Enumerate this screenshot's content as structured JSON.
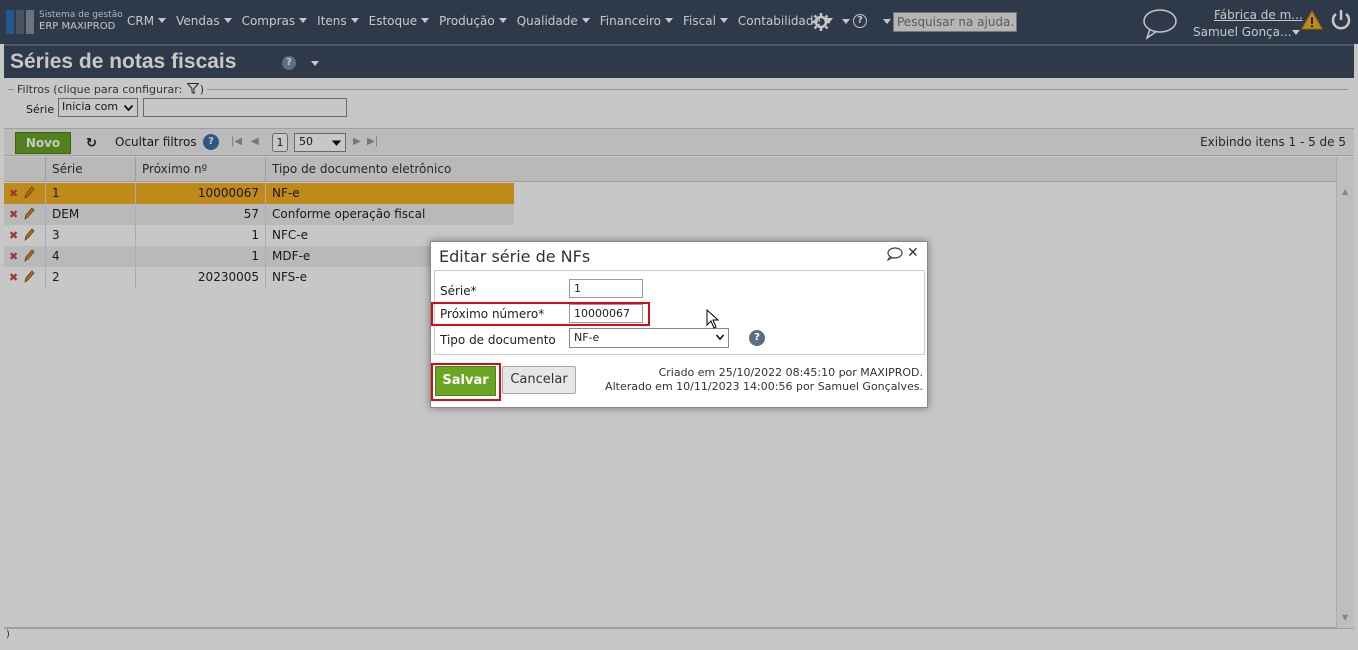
{
  "app": {
    "brand_line1": "Sistema de gestão",
    "brand_line2": "ERP MAXIPROD",
    "menu": [
      "CRM",
      "Vendas",
      "Compras",
      "Itens",
      "Estoque",
      "Produção",
      "Qualidade",
      "Financeiro",
      "Fiscal",
      "Contabilidade"
    ],
    "help_glyph": "?",
    "search_placeholder": "Pesquisar na ajuda...",
    "company": "Fábrica de m...",
    "user": "Samuel Gonça...",
    "icons": [
      "gear-icon",
      "help-icon",
      "chat-icon",
      "warning-icon",
      "power-icon"
    ]
  },
  "page": {
    "title": "Séries de notas fiscais",
    "help_glyph": "?"
  },
  "filters": {
    "legend": "Filtros (clique para configurar:",
    "legend_close": ")",
    "serie_label": "Série",
    "serie_mode": "Inicia com",
    "serie_value": ""
  },
  "toolbar": {
    "new_label": "Novo",
    "refresh_glyph": "↻",
    "hide_filters_label": "Ocultar filtros",
    "help_glyph": "?",
    "first_glyph": "|◀",
    "prev_glyph": "◀",
    "next_glyph": "▶",
    "last_glyph": "▶|",
    "page": "1",
    "page_size": "50",
    "showing": "Exibindo itens 1 - 5 de 5"
  },
  "grid": {
    "columns": [
      "Série",
      "Próximo nº",
      "Tipo de documento eletrônico"
    ],
    "rows": [
      {
        "serie": "1",
        "proximo": "10000067",
        "tipo": "NF-e",
        "selected": true
      },
      {
        "serie": "DEM",
        "proximo": "57",
        "tipo": "Conforme operação fiscal",
        "selected": false
      },
      {
        "serie": "3",
        "proximo": "1",
        "tipo": "NFC-e",
        "selected": false
      },
      {
        "serie": "4",
        "proximo": "1",
        "tipo": "MDF-e",
        "selected": false
      },
      {
        "serie": "2",
        "proximo": "20230005",
        "tipo": "NFS-e",
        "selected": false
      }
    ],
    "delete_glyph": "✖",
    "scroll_up_glyph": "▲",
    "scroll_down_glyph": "▼"
  },
  "bottom": {
    "text": ")"
  },
  "dialog": {
    "title": "Editar série de NFs",
    "close_glyph": "✕",
    "serie_label": "Série*",
    "serie_value": "1",
    "proximo_label": "Próximo número*",
    "proximo_value": "10000067",
    "tipo_label": "Tipo de documento",
    "tipo_value": "NF-e",
    "help_glyph": "?",
    "save_label": "Salvar",
    "cancel_label": "Cancelar",
    "created": "Criado em 25/10/2022 08:45:10 por MAXIPROD.",
    "modified": "Alterado em 10/11/2023 14:00:56 por Samuel Gonçalves."
  },
  "colors": {
    "header_bg": "#3b4b5e",
    "accent_green": "#6aa524",
    "selected_row": "#f5b122",
    "highlight_red": "#d01010"
  }
}
